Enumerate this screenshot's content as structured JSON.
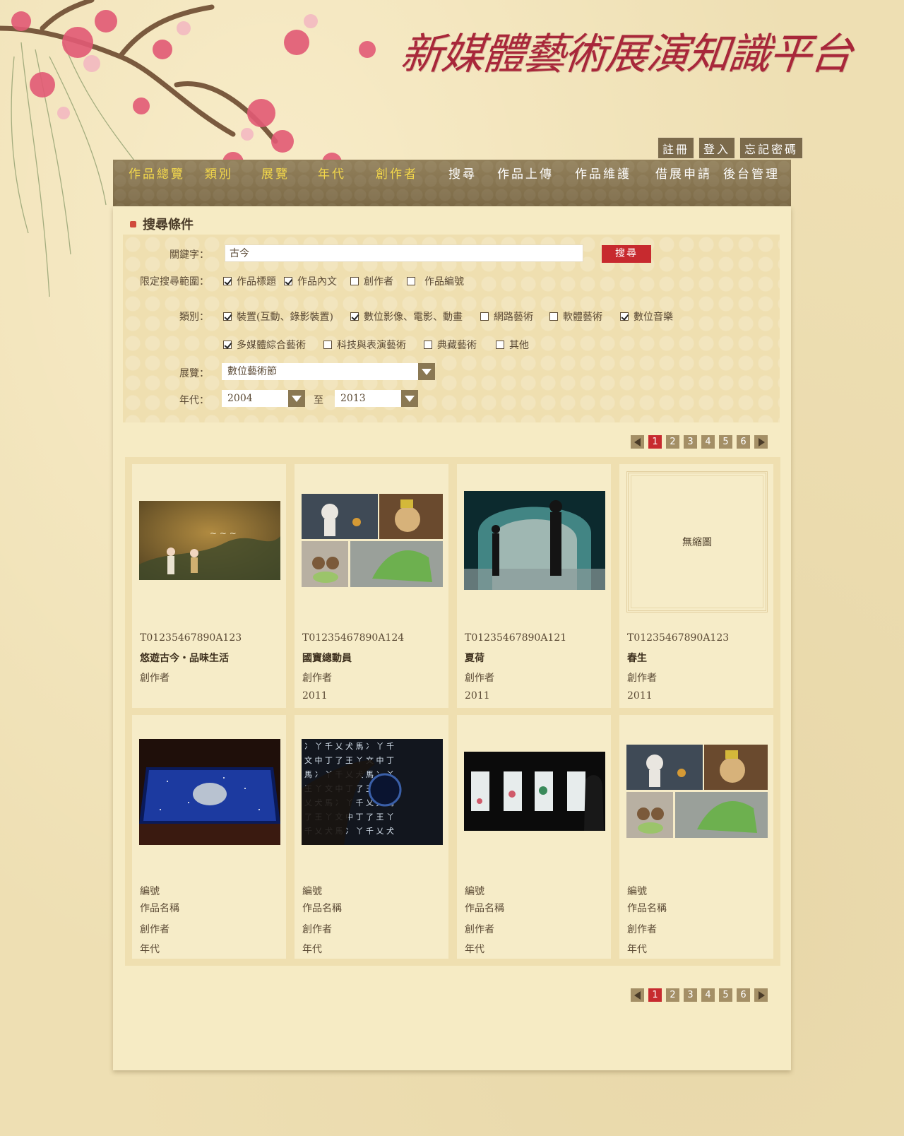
{
  "site": {
    "title": "新媒體藝術展演知識平台"
  },
  "account": {
    "register": "註冊",
    "login": "登入",
    "forgot": "忘記密碼"
  },
  "nav": [
    {
      "label": "作品總覽"
    },
    {
      "label": "類別"
    },
    {
      "label": "展覽"
    },
    {
      "label": "年代"
    },
    {
      "label": "創作者"
    },
    {
      "label": "搜尋"
    },
    {
      "label": "作品上傳"
    },
    {
      "label": "作品維護"
    },
    {
      "label": "借展申請"
    },
    {
      "label": "後台管理"
    }
  ],
  "search": {
    "heading": "搜尋條件",
    "keyword_label": "關鍵字：",
    "keyword_value": "古今",
    "button": "搜尋",
    "scope_label": "限定搜尋範圍：",
    "scope": [
      {
        "label": "作品標題",
        "checked": true
      },
      {
        "label": "作品內文",
        "checked": true
      },
      {
        "label": "創作者",
        "checked": false
      },
      {
        "label": "作品編號",
        "checked": false
      }
    ],
    "category_label": "類別：",
    "categories": [
      {
        "label": "裝置(互動、錄影裝置)",
        "checked": true
      },
      {
        "label": "數位影像、電影、動畫",
        "checked": true
      },
      {
        "label": "網路藝術",
        "checked": false
      },
      {
        "label": "軟體藝術",
        "checked": false
      },
      {
        "label": "數位音樂",
        "checked": true
      },
      {
        "label": "多媒體綜合藝術",
        "checked": true
      },
      {
        "label": "科技與表演藝術",
        "checked": false
      },
      {
        "label": "典藏藝術",
        "checked": false
      },
      {
        "label": "其他",
        "checked": false
      }
    ],
    "exhibition_label": "展覽：",
    "exhibition_value": "數位藝術節",
    "year_label": "年代：",
    "year_from": "2004",
    "year_to_sep": "至",
    "year_to": "2013"
  },
  "pager": {
    "pages": [
      "1",
      "2",
      "3",
      "4",
      "5",
      "6"
    ],
    "current": "1"
  },
  "items": [
    {
      "id": "T01235467890A123",
      "title": "悠遊古今・品味生活",
      "author": "創作者",
      "year": "",
      "thumb": "painting"
    },
    {
      "id": "T01235467890A124",
      "title": "國寶總動員",
      "author": "創作者",
      "year": "2011",
      "thumb": "collage"
    },
    {
      "id": "T01235467890A121",
      "title": "夏荷",
      "author": "創作者",
      "year": "2011",
      "thumb": "dome"
    },
    {
      "id": "T01235467890A123",
      "title": "春生",
      "author": "創作者",
      "year": "2011",
      "thumb": "none",
      "no_thumb_text": "無縮圖"
    },
    {
      "id": "編號",
      "title": "作品名稱",
      "author": "創作者",
      "year": "年代",
      "thumb": "table"
    },
    {
      "id": "編號",
      "title": "作品名稱",
      "author": "創作者",
      "year": "年代",
      "thumb": "script"
    },
    {
      "id": "編號",
      "title": "作品名稱",
      "author": "創作者",
      "year": "年代",
      "thumb": "panels"
    },
    {
      "id": "編號",
      "title": "作品名稱",
      "author": "創作者",
      "year": "年代",
      "thumb": "collage"
    }
  ]
}
